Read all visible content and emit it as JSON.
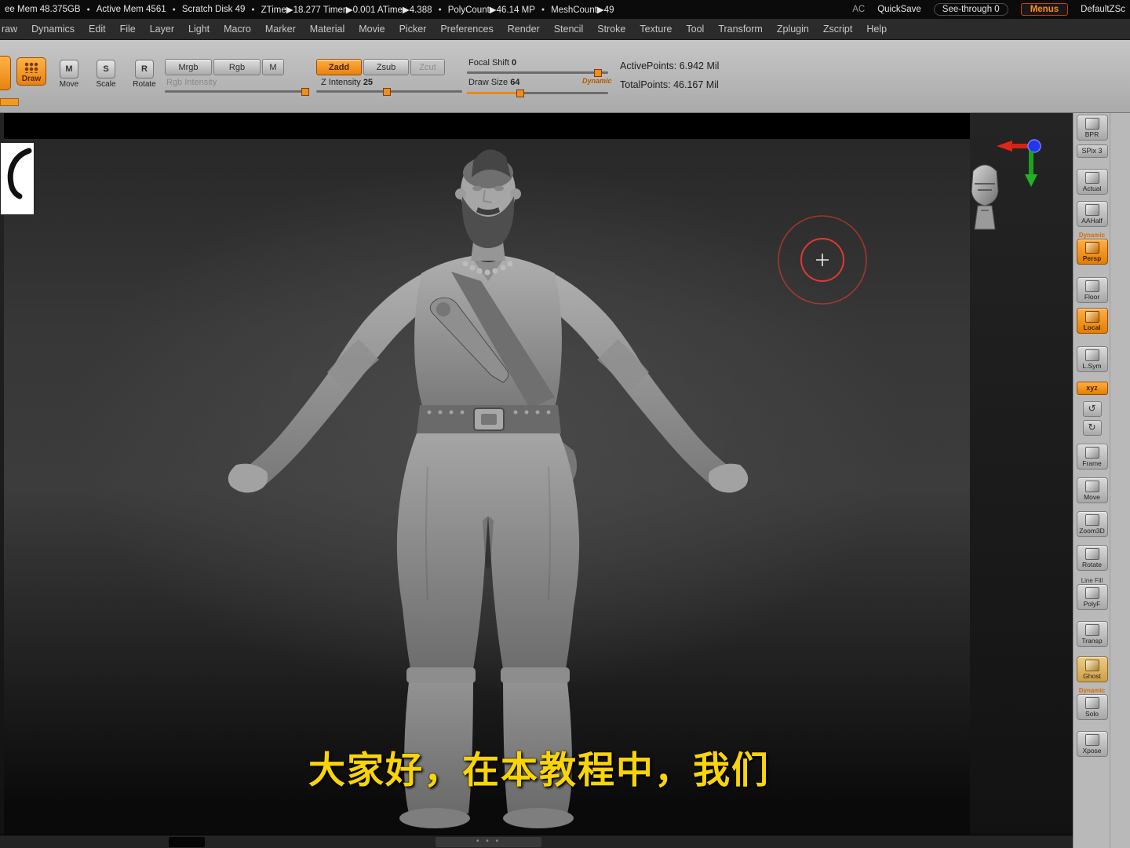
{
  "status_bar": {
    "left_items": [
      "ee Mem 48.375GB",
      "Active Mem 4561",
      "Scratch Disk 49",
      "ZTime▶18.277 Timer▶0.001 ATime▶4.388",
      "PolyCount▶46.14 MP",
      "MeshCount▶49"
    ],
    "right": {
      "ac": "AC",
      "quicksave": "QuickSave",
      "see_through": "See-through  0",
      "menus": "Menus",
      "default_doc": "DefaultZSc"
    }
  },
  "menu_bar": {
    "items": [
      "raw",
      "Dynamics",
      "Edit",
      "File",
      "Layer",
      "Light",
      "Macro",
      "Marker",
      "Material",
      "Movie",
      "Picker",
      "Preferences",
      "Render",
      "Stencil",
      "Stroke",
      "Texture",
      "Tool",
      "Transform",
      "Zplugin",
      "Zscript",
      "Help"
    ]
  },
  "toolbar": {
    "tools": [
      {
        "label": "Draw",
        "letter": ""
      },
      {
        "label": "Move",
        "letter": "M"
      },
      {
        "label": "Scale",
        "letter": "S"
      },
      {
        "label": "Rotate",
        "letter": "R"
      }
    ],
    "color_buttons": [
      "Mrgb",
      "Rgb",
      "M"
    ],
    "rgb_intensity_label": "Rgb Intensity",
    "sculpt_buttons": [
      {
        "label": "Zadd"
      },
      {
        "label": "Zsub"
      },
      {
        "label": "Zcut"
      }
    ],
    "z_intensity_label": "Z Intensity",
    "z_intensity_value": "25",
    "focal_shift_label": "Focal Shift",
    "focal_shift_value": "0",
    "draw_size_label": "Draw Size",
    "draw_size_value": "64",
    "dynamic_label": "Dynamic",
    "active_points": "ActivePoints: 6.942 Mil",
    "total_points": "TotalPoints: 46.167 Mil"
  },
  "right_shelf": {
    "buttons": [
      {
        "label": "BPR",
        "name": "bpr",
        "mt": 2
      },
      {
        "label": "SPix 3",
        "name": "spix",
        "type": "slider",
        "mt": 5
      },
      {
        "label": "Actual",
        "name": "actual",
        "mt": 14
      },
      {
        "label": "AAHalf",
        "name": "aahalf",
        "mt": 8
      },
      {
        "label": "Persp",
        "name": "persp",
        "accent": "orange",
        "top": "Dynamic",
        "mt": 6
      },
      {
        "label": "Floor",
        "name": "floor",
        "mt": 16
      },
      {
        "label": "Local",
        "name": "local",
        "accent": "orange",
        "mt": 6
      },
      {
        "label": "L.Sym",
        "name": "lsym",
        "mt": 16
      },
      {
        "label": "xyz",
        "name": "xyz",
        "accent": "orange",
        "type": "slider",
        "mt": 12
      },
      {
        "label": "",
        "name": "rotate-ccw",
        "type": "mini",
        "glyph": "↺",
        "mt": 8
      },
      {
        "label": "",
        "name": "rotate-cw",
        "type": "mini",
        "glyph": "↻",
        "mt": 4
      },
      {
        "label": "Frame",
        "name": "frame",
        "mt": 10
      },
      {
        "label": "Move",
        "name": "move",
        "mt": 10
      },
      {
        "label": "Zoom3D",
        "name": "zoom3d",
        "mt": 10
      },
      {
        "label": "Rotate",
        "name": "rotate",
        "mt": 10
      },
      {
        "label": "PolyF",
        "name": "polyf",
        "top": "Line Fill",
        "mt": 8
      },
      {
        "label": "Transp",
        "name": "transp",
        "mt": 14
      },
      {
        "label": "Ghost",
        "name": "ghost",
        "accent": "tan",
        "mt": 12
      },
      {
        "label": "Solo",
        "name": "solo",
        "top": "Dynamic",
        "mt": 6
      },
      {
        "label": "Xpose",
        "name": "xpose",
        "mt": 14
      }
    ]
  },
  "canvas": {
    "subtitle": "大家好，在本教程中，我们"
  },
  "colors": {
    "accent_orange": "#e8820e",
    "subtitle_yellow": "#f8d408",
    "cursor_red": "#ff3b30"
  }
}
